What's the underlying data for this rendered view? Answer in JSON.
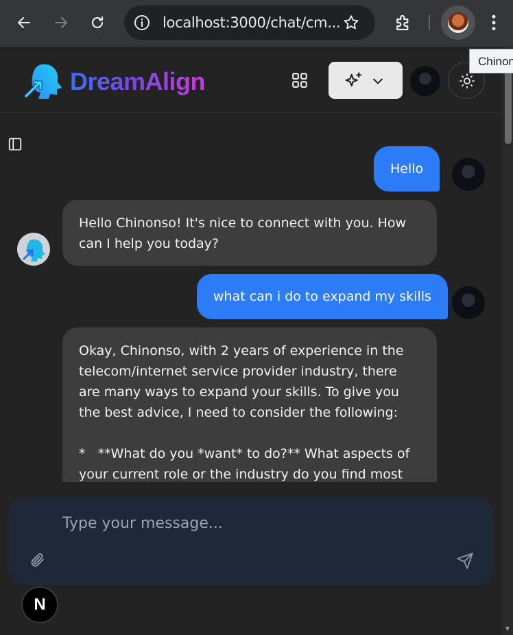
{
  "browser": {
    "url": "localhost:3000/chat/cm...",
    "tooltip": "Chinon"
  },
  "header": {
    "brand": "DreamAlign"
  },
  "messages": [
    {
      "role": "user",
      "text": "Hello"
    },
    {
      "role": "assistant",
      "text": "Hello Chinonso! It's nice to connect with you. How can I help you today?"
    },
    {
      "role": "user",
      "text": "what can i do to expand my skills"
    },
    {
      "role": "assistant",
      "text": "Okay, Chinonso, with 2 years of experience in the telecom/internet service provider industry, there are many ways to expand your skills. To give you the best advice, I need to consider the following:\n\n*   **What do you *want* to do?** What aspects of your current role or the industry do you find most"
    }
  ],
  "composer": {
    "placeholder": "Type your message..."
  },
  "dev_badge": "N",
  "colors": {
    "user_bubble": "#2b7cf6",
    "assistant_bubble": "#3d3d3d",
    "composer_bg": "#1e2838",
    "page_bg": "#232323"
  }
}
